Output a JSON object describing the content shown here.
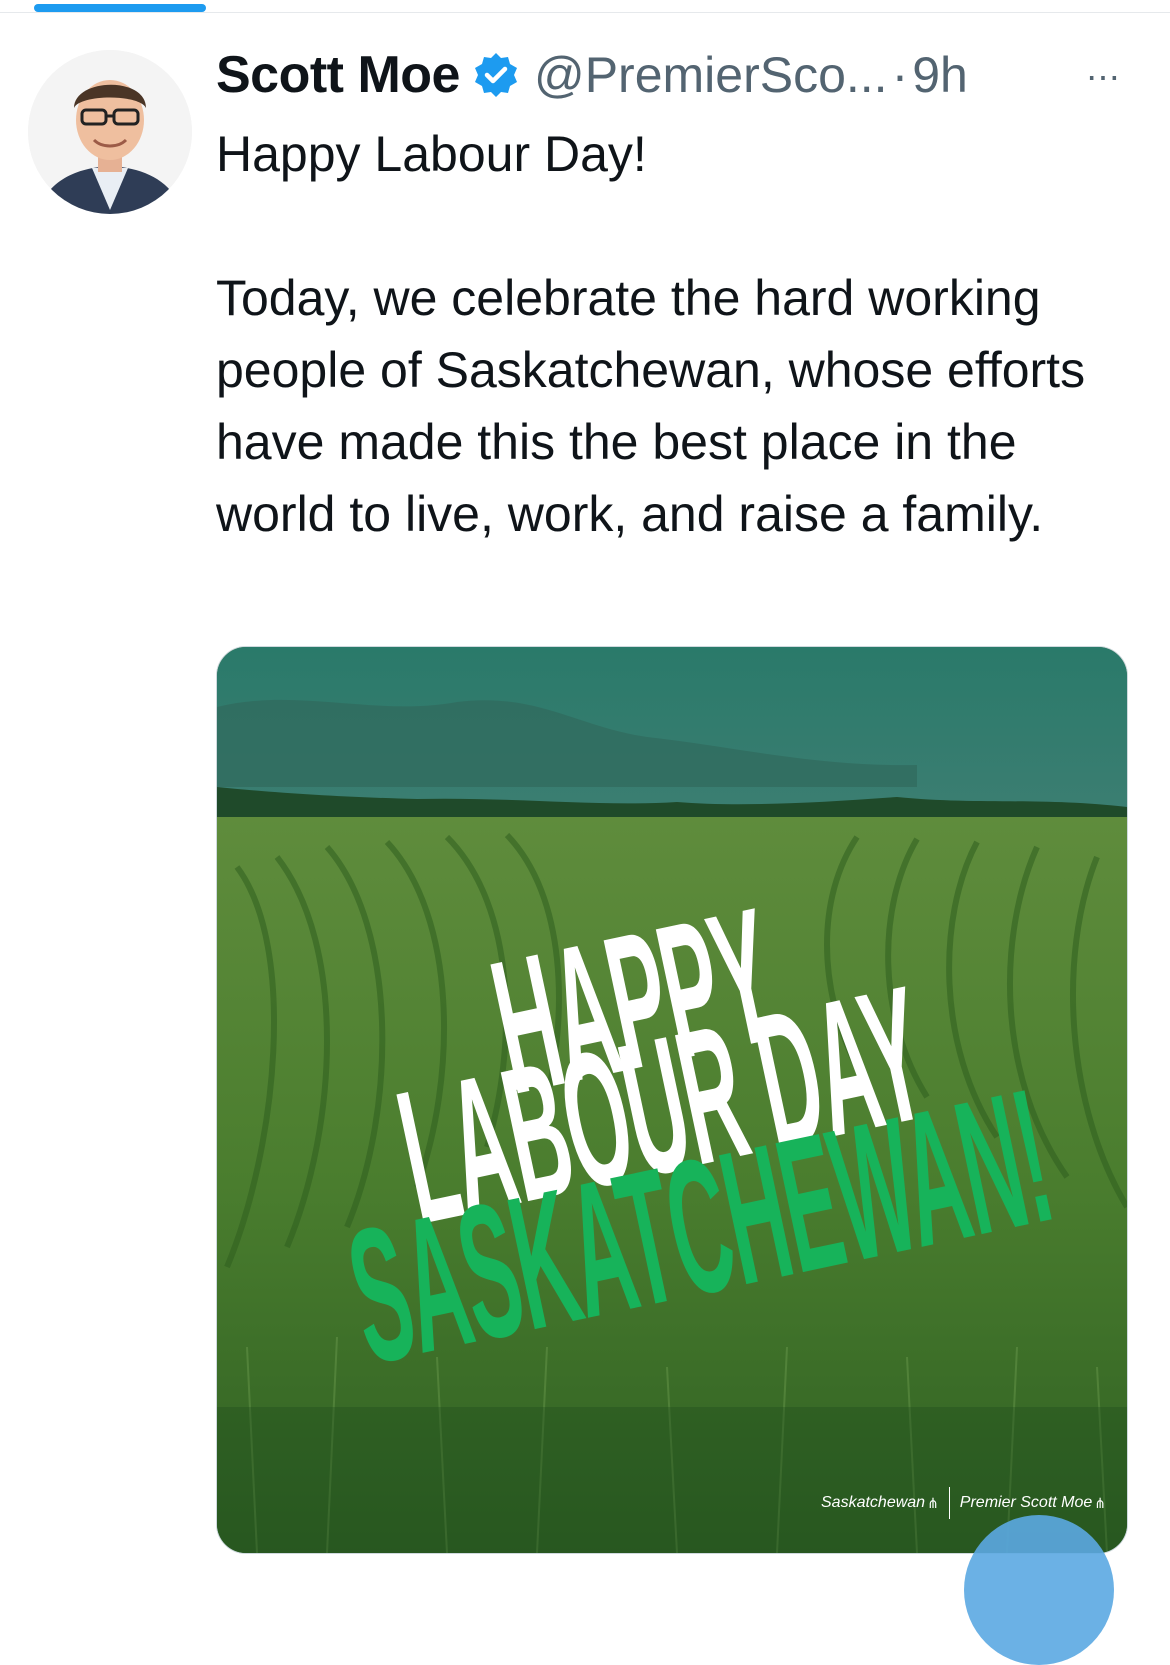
{
  "tweet": {
    "author_name": "Scott Moe",
    "handle": "@PremierSco...",
    "separator": "·",
    "time": "9h",
    "more_icon": "⋯",
    "paragraphs": [
      "Happy Labour Day!",
      "Today, we celebrate the hard working people of Saskatchewan, whose efforts have made this the best place in the world to live, work, and raise a family."
    ]
  },
  "media": {
    "headline_line1": "HAPPY",
    "headline_line2": "LABOUR DAY",
    "headline_line3": "SASKATCHEWAN!",
    "brand_left": "Saskatchewan",
    "brand_right": "Premier Scott Moe",
    "accent_color": "#17b35a"
  },
  "colors": {
    "tab_indicator": "#1d9bf0",
    "verified_badge": "#1d9bf0",
    "secondary_text": "#536471"
  }
}
